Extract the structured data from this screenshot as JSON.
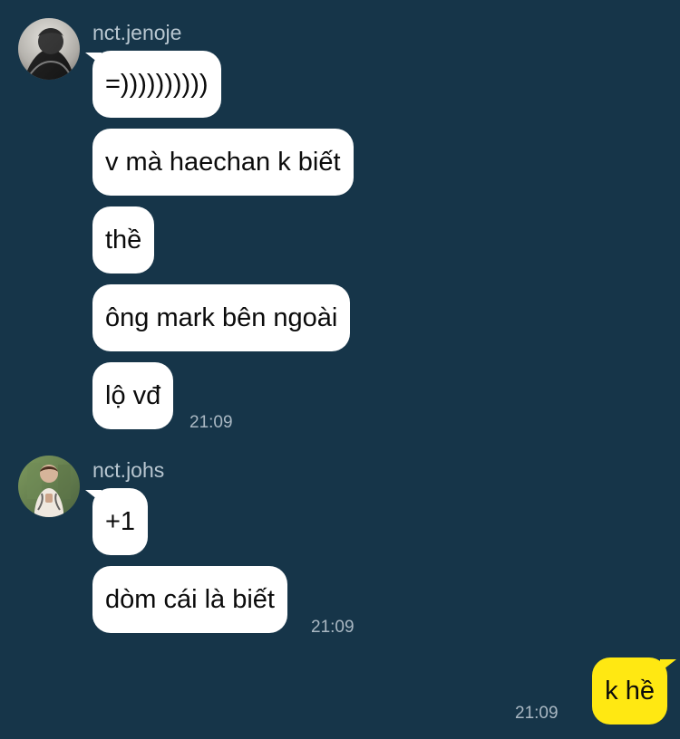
{
  "thread": {
    "groups": [
      {
        "sender": "nct.jenoje",
        "messages": [
          "=))))))))))",
          "v mà haechan k biết",
          "thề",
          "ông mark bên ngoài",
          "lộ vđ"
        ],
        "time": "21:09"
      },
      {
        "sender": "nct.johs",
        "messages": [
          "+1",
          "dòm cái là biết"
        ],
        "time": "21:09"
      }
    ],
    "outgoing": {
      "message": "k hề",
      "time": "21:09"
    }
  },
  "colors": {
    "background": "#163549",
    "incoming_bubble": "#ffffff",
    "outgoing_bubble": "#ffe812",
    "meta_text": "#aab8c3"
  },
  "icons": {
    "avatar_1": "profile-photo-avatar",
    "avatar_2": "profile-photo-avatar"
  }
}
